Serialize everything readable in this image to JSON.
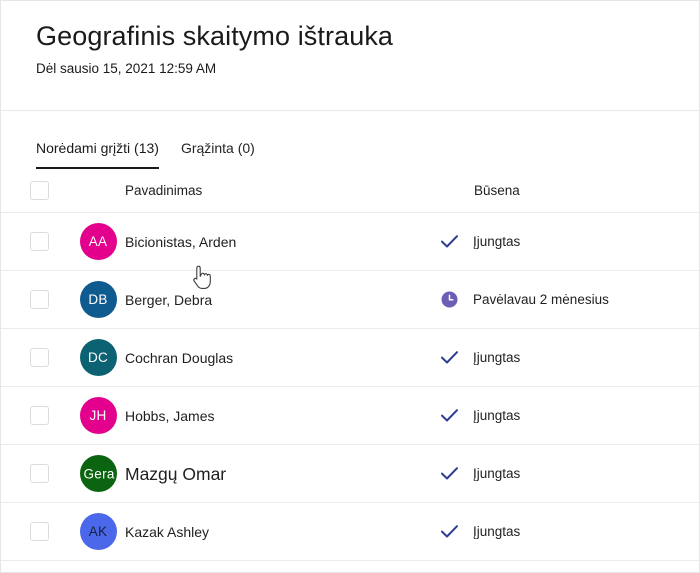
{
  "header": {
    "title": "Geografinis skaitymo ištrauka",
    "subtitle": "Dėl sausio 15, 2021 12:59 AM"
  },
  "tabs": [
    {
      "label": "Norėdami grįžti (13)",
      "active": true
    },
    {
      "label": "Grąžinta (0)",
      "active": false
    }
  ],
  "table": {
    "columns": {
      "name": "Pavadinimas",
      "status": "Būsena"
    },
    "rows": [
      {
        "initials": "AA",
        "avatar_color": "#e3008c",
        "avatar_text_color": "#ffffff",
        "name": "Bicionistas, Arden",
        "status_icon": "check-icon",
        "status_color": "#2f3e8f",
        "status": "Įjungtas",
        "name_large": false,
        "initials_overflow": false
      },
      {
        "initials": "DB",
        "avatar_color": "#0f5a8f",
        "avatar_text_color": "#ffffff",
        "name": "Berger, Debra",
        "status_icon": "clock-icon",
        "status_color": "#6b5fb5",
        "status": "Pavėlavau 2 mėnesius",
        "name_large": false,
        "initials_overflow": false
      },
      {
        "initials": "DC",
        "avatar_color": "#0c6272",
        "avatar_text_color": "#ffffff",
        "name": "Cochran Douglas",
        "status_icon": "check-icon",
        "status_color": "#2f3e8f",
        "status": "Įjungtas",
        "name_large": false,
        "initials_overflow": false
      },
      {
        "initials": "JH",
        "avatar_color": "#e3008c",
        "avatar_text_color": "#ffffff",
        "name": "Hobbs, James",
        "status_icon": "check-icon",
        "status_color": "#2f3e8f",
        "status": "Įjungtas",
        "name_large": false,
        "initials_overflow": false
      },
      {
        "initials": "Gera",
        "avatar_color": "#0b6510",
        "avatar_text_color": "#ffffff",
        "name": "Mazgų Omar",
        "status_icon": "check-icon",
        "status_color": "#2f3e8f",
        "status": "Įjungtas",
        "name_large": true,
        "initials_overflow": true
      },
      {
        "initials": "AK",
        "avatar_color": "#4c68ea",
        "avatar_text_color": "#15213f",
        "name": "Kazak Ashley",
        "status_icon": "check-icon",
        "status_color": "#2f3e8f",
        "status": "Įjungtas",
        "name_large": false,
        "initials_overflow": false
      }
    ]
  },
  "cursor": {
    "type": "pointing-hand-cursor"
  }
}
